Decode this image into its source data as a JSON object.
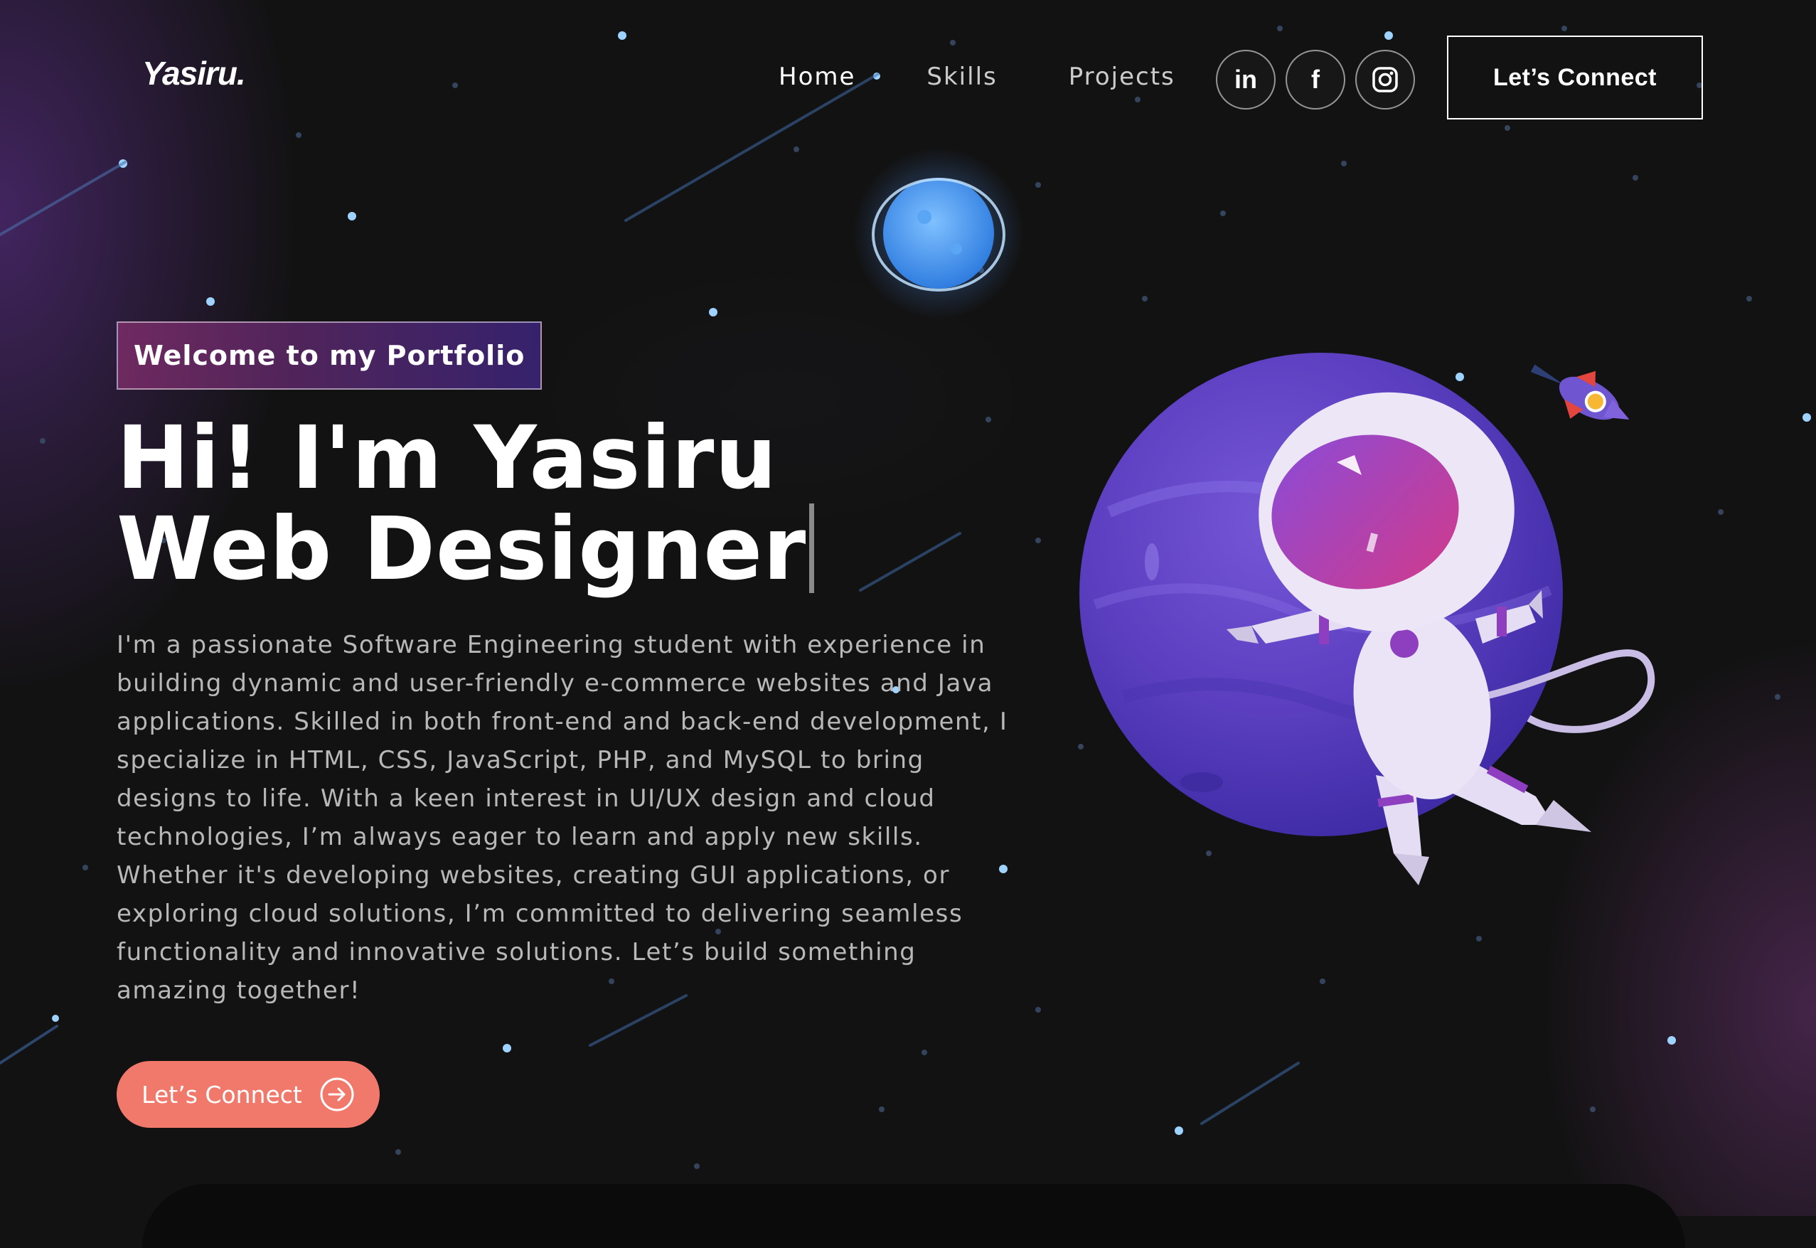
{
  "brand": {
    "logo": "Yasiru."
  },
  "nav": {
    "links": [
      "Home",
      "Skills",
      "Projects"
    ],
    "socials": [
      {
        "label": "in",
        "icon": "linkedin-icon"
      },
      {
        "label": "f",
        "icon": "facebook-icon"
      },
      {
        "label": "",
        "icon": "instagram-icon"
      }
    ],
    "connect_label": "Let’s Connect"
  },
  "hero": {
    "tagline": "Welcome to my Portfolio",
    "headline_line1": "Hi! I'm Yasiru",
    "headline_line2": "Web Designer",
    "bio": "I'm a passionate Software Engineering student with experience in building dynamic and user-friendly e-commerce websites and Java applications. Skilled in both front-end and back-end development, I specialize in HTML, CSS, JavaScript, PHP, and MySQL to bring designs to life. With a keen interest in UI/UX design and cloud technologies, I’m always eager to learn and apply new skills. Whether it's developing websites, creating GUI applications, or exploring cloud solutions, I’m committed to delivering seamless functionality and innovative solutions. Let’s build something amazing together!",
    "cta_label": "Let’s Connect",
    "cta_icon": "arrow-right-circle-icon"
  },
  "colors": {
    "background": "#121212",
    "accent": "#f0796b",
    "tagline_gradient_start": "#aa367c",
    "tagline_gradient_end": "#4a2fbd",
    "planet": "#5b3fc0"
  },
  "illustration": {
    "icons": [
      "astronaut-icon",
      "planet-icon",
      "small-planet-icon",
      "rocket-icon"
    ]
  }
}
